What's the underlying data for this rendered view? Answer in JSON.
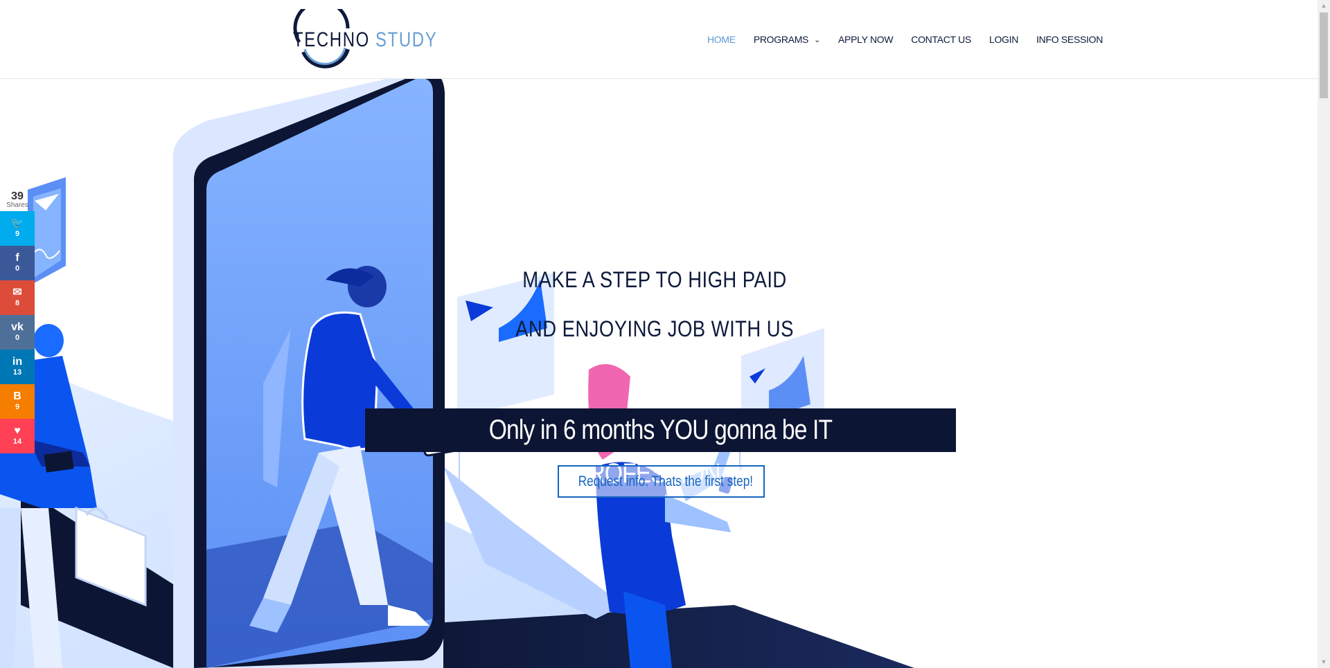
{
  "header": {
    "logo": {
      "part1": "TECHNO",
      "part2": "STUDY"
    },
    "nav": [
      {
        "label": "HOME",
        "active": true
      },
      {
        "label": "PROGRAMS",
        "dropdown": true
      },
      {
        "label": "APPLY NOW"
      },
      {
        "label": "CONTACT US"
      },
      {
        "label": "LOGIN"
      },
      {
        "label": "INFO SESSION"
      }
    ]
  },
  "hero": {
    "headline_line1": "MAKE A STEP TO HIGH PAID",
    "headline_line2": "AND ENJOYING JOB WITH US",
    "banner": "Only in 6 months YOU gonna be IT PROFESSIONAL",
    "cta": "Request info. Thats the first step!"
  },
  "share": {
    "total": "39",
    "total_label": "Shares",
    "buttons": [
      {
        "network": "twitter",
        "icon": "twitter-icon",
        "count": "9",
        "color": "#00aced"
      },
      {
        "network": "facebook",
        "icon": "facebook-icon",
        "count": "0",
        "color": "#3b5998"
      },
      {
        "network": "email",
        "icon": "email-icon",
        "count": "8",
        "color": "#dd4b39"
      },
      {
        "network": "vk",
        "icon": "vk-icon",
        "count": "0",
        "color": "#4e6f98"
      },
      {
        "network": "linkedin",
        "icon": "linkedin-icon",
        "count": "13",
        "color": "#0077b5"
      },
      {
        "network": "blogger",
        "icon": "blogger-icon",
        "count": "9",
        "color": "#f57d00"
      },
      {
        "network": "love",
        "icon": "heart-icon",
        "count": "14",
        "color": "#ff4055"
      }
    ]
  },
  "colors": {
    "navy": "#0c1533",
    "accent": "#1565c0",
    "active_nav": "#5b9bd5"
  }
}
